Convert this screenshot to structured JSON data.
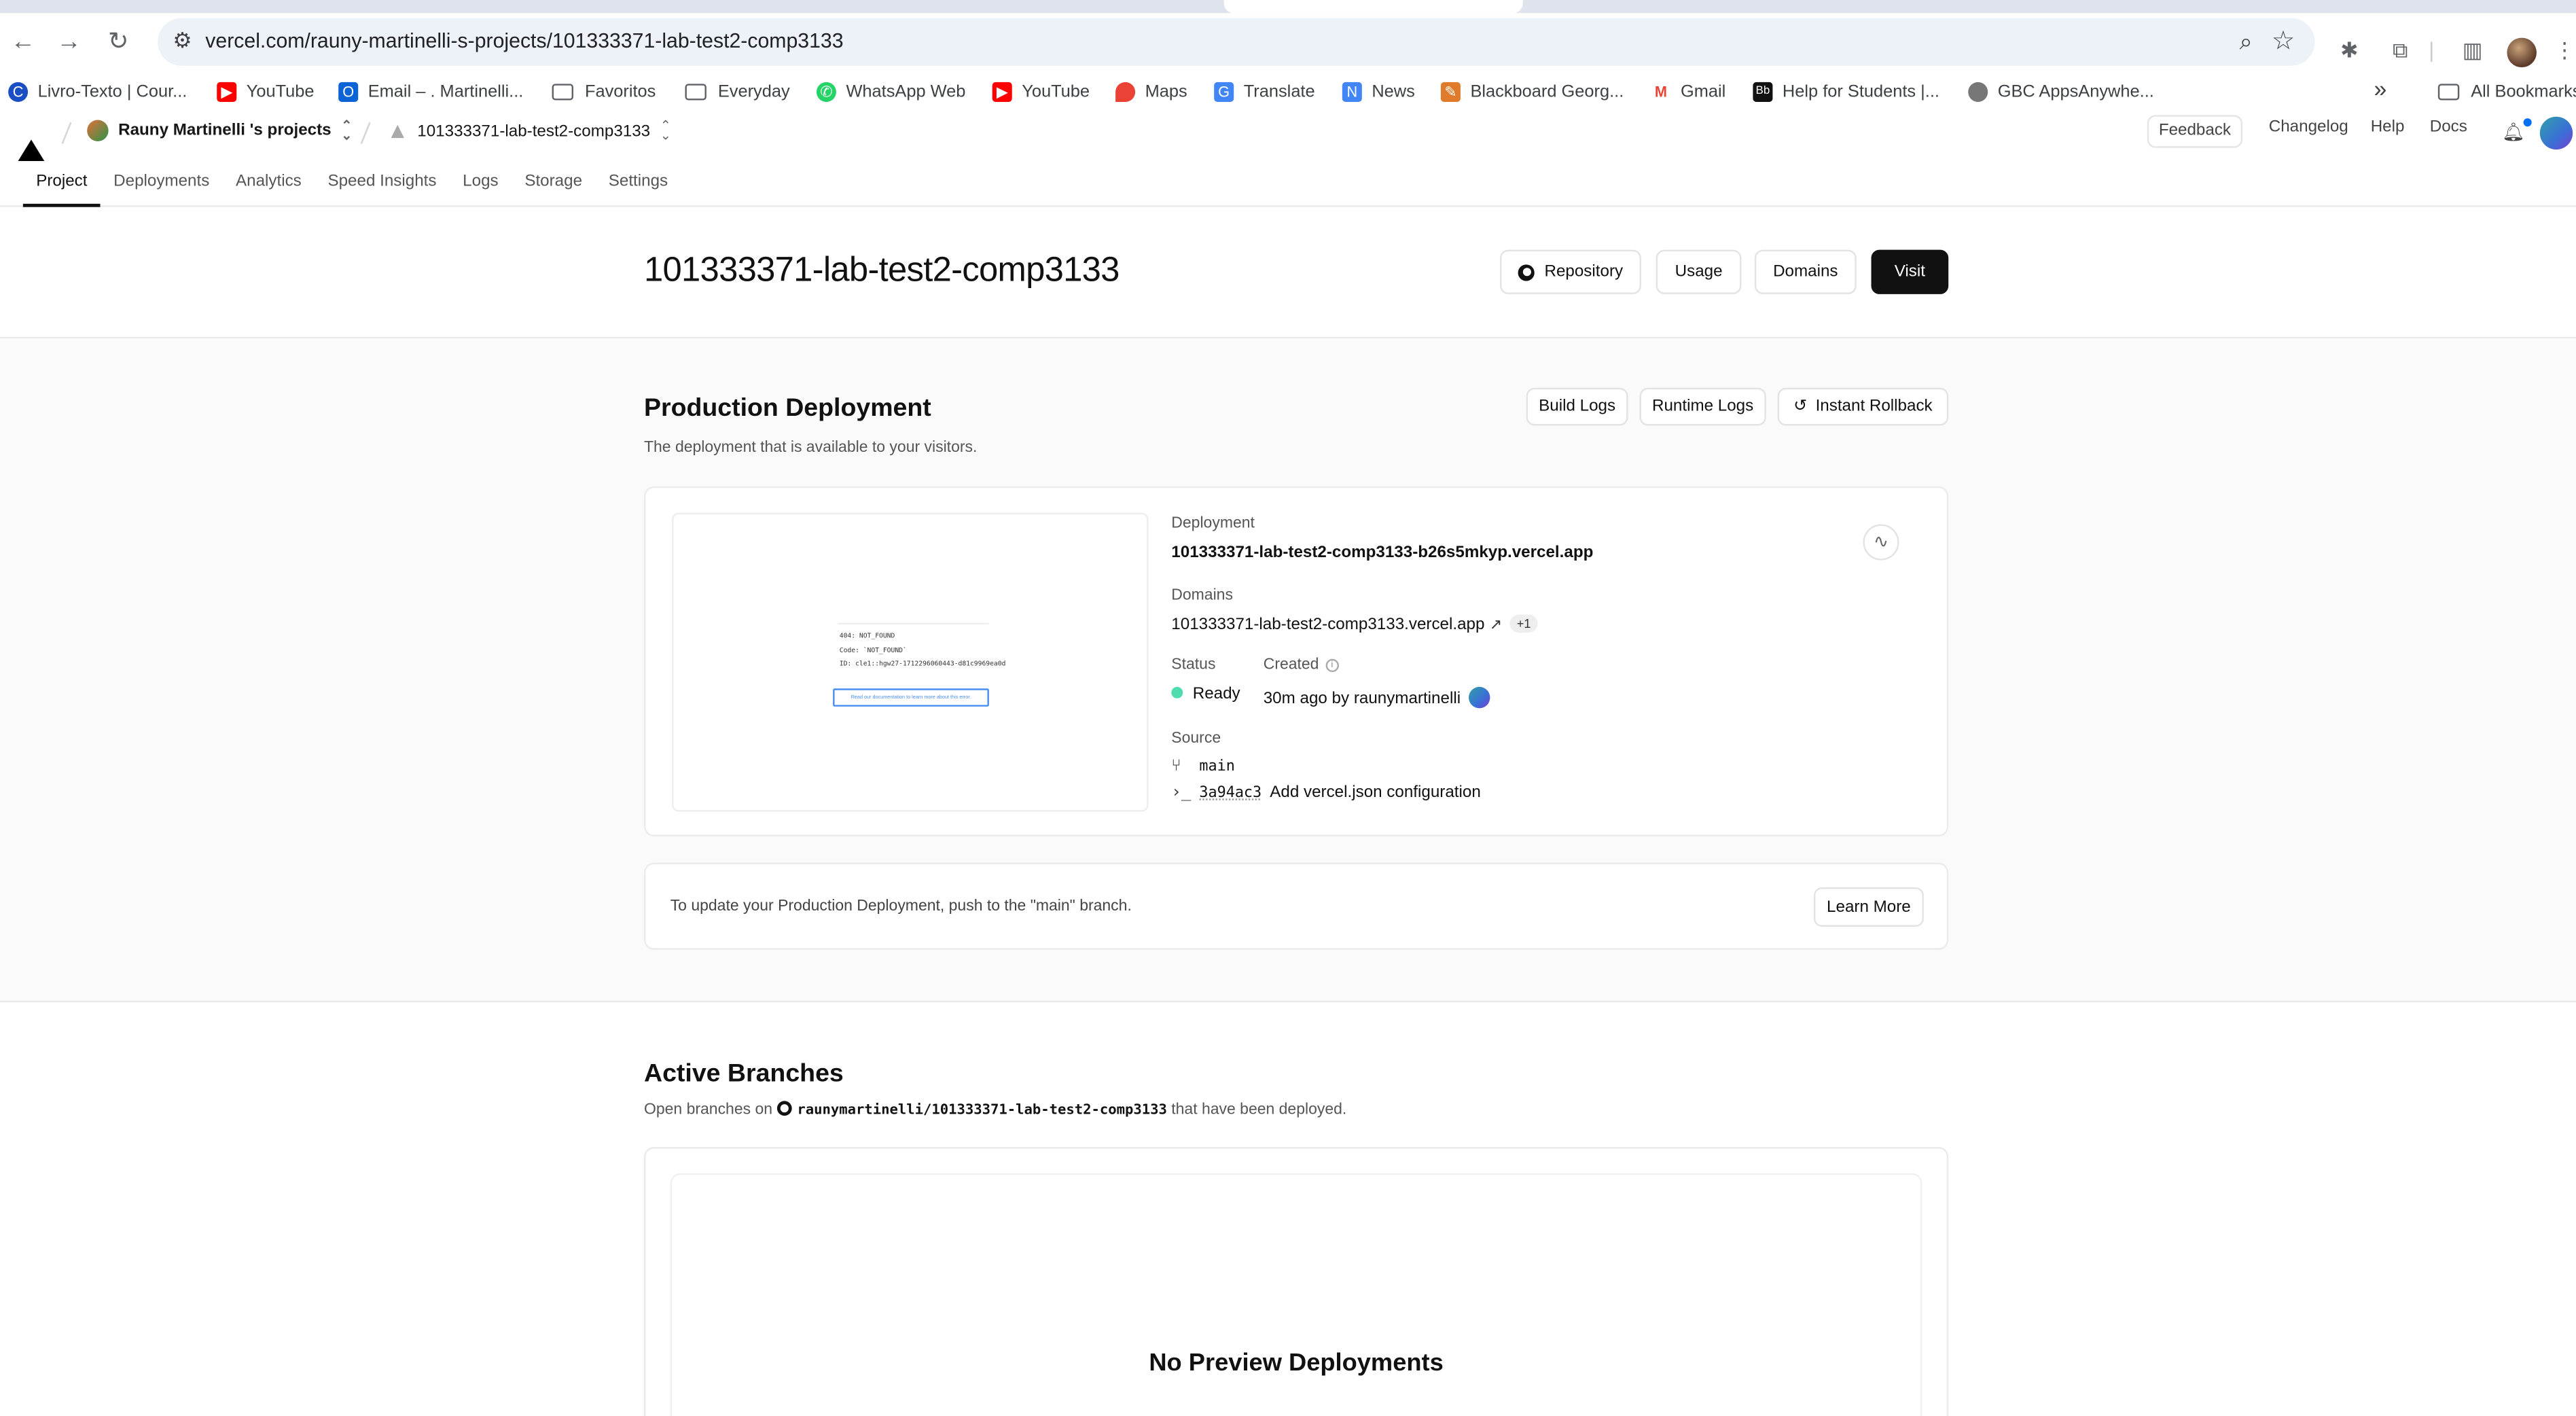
{
  "browser": {
    "url": "vercel.com/rauny-martinelli-s-projects/101333371-lab-test2-comp3133",
    "bookmarks": [
      {
        "label": "Livro-Texto | Cour...",
        "icon": "c-circle-icon",
        "color": "#1a4fc4"
      },
      {
        "label": "YouTube",
        "icon": "youtube-icon",
        "color": "#ff0000"
      },
      {
        "label": "Email – . Martinelli...",
        "icon": "outlook-icon",
        "color": "#0a64d6"
      },
      {
        "label": "Favoritos",
        "icon": "folder-icon",
        "color": ""
      },
      {
        "label": "Everyday",
        "icon": "folder-icon",
        "color": ""
      },
      {
        "label": "WhatsApp Web",
        "icon": "whatsapp-icon",
        "color": "#25d366"
      },
      {
        "label": "YouTube",
        "icon": "youtube-icon",
        "color": "#ff0000"
      },
      {
        "label": "Maps",
        "icon": "maps-icon",
        "color": "#ea4335"
      },
      {
        "label": "Translate",
        "icon": "translate-icon",
        "color": "#4285f4"
      },
      {
        "label": "News",
        "icon": "news-icon",
        "color": "#4285f4"
      },
      {
        "label": "Blackboard Georg...",
        "icon": "blackboard-icon",
        "color": "#e07b2b"
      },
      {
        "label": "Gmail",
        "icon": "gmail-icon",
        "color": "#ea4335"
      },
      {
        "label": "Help for Students |...",
        "icon": "bb-icon",
        "color": "#111111"
      },
      {
        "label": "GBC AppsAnywhe...",
        "icon": "globe-icon",
        "color": "#777777"
      }
    ],
    "all_bookmarks": "All Bookmarks",
    "more": "»"
  },
  "header": {
    "team": "Rauny Martinelli 's projects",
    "project": "101333371-lab-test2-comp3133",
    "feedback": "Feedback",
    "changelog": "Changelog",
    "help": "Help",
    "docs": "Docs",
    "tabs": [
      "Project",
      "Deployments",
      "Analytics",
      "Speed Insights",
      "Logs",
      "Storage",
      "Settings"
    ],
    "active_tab": "Project"
  },
  "project": {
    "title": "101333371-lab-test2-comp3133",
    "buttons": {
      "repository": "Repository",
      "usage": "Usage",
      "domains": "Domains",
      "visit": "Visit"
    }
  },
  "production": {
    "title": "Production Deployment",
    "subtitle": "The deployment that is available to your visitors.",
    "buttons": {
      "build_logs": "Build Logs",
      "runtime_logs": "Runtime Logs",
      "rollback": "Instant Rollback"
    },
    "preview": {
      "line1": "404: NOT_FOUND",
      "line2": "Code: `NOT_FOUND`",
      "line3": "ID: cle1::hgw27-1712296060443-d81c9969ea0d",
      "button": "Read our documentation to learn more about this error."
    },
    "deployment_label": "Deployment",
    "deployment_url": "101333371-lab-test2-comp3133-b26s5mkyp.vercel.app",
    "domains_label": "Domains",
    "domain": "101333371-lab-test2-comp3133.vercel.app",
    "domain_extra": "+1",
    "status_label": "Status",
    "status": "Ready",
    "status_color": "#4fdcb0",
    "created_label": "Created",
    "created": "30m ago by raunymartinelli",
    "source_label": "Source",
    "branch": "main",
    "commit_hash": "3a94ac3",
    "commit_msg": "Add vercel.json configuration",
    "notice": "To update your Production Deployment, push to the \"main\" branch.",
    "learn_more": "Learn More"
  },
  "branches": {
    "title": "Active Branches",
    "sub_pre": "Open branches on",
    "repo": "raunymartinelli/101333371-lab-test2-comp3133",
    "sub_post": "that have been deployed.",
    "empty_title": "No Preview Deployments"
  }
}
